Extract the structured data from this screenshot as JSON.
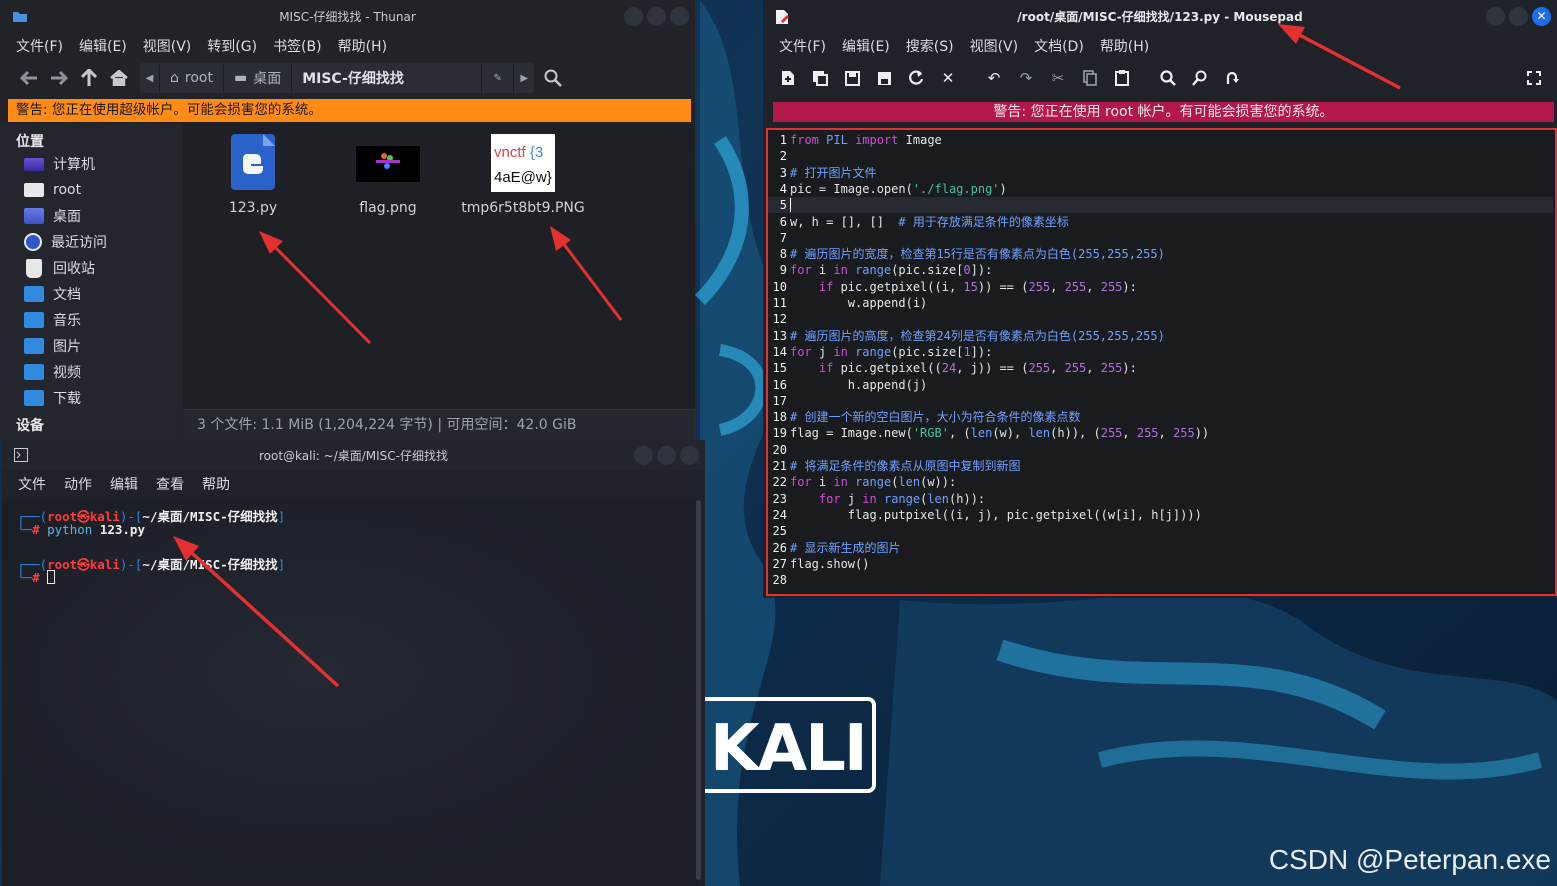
{
  "thunar": {
    "title": "MISC-仔细找找 - Thunar",
    "menu": [
      "文件(F)",
      "编辑(E)",
      "视图(V)",
      "转到(G)",
      "书签(B)",
      "帮助(H)"
    ],
    "path": [
      "root",
      "桌面",
      "MISC-仔细找找"
    ],
    "warning": "警告: 您正在使用超级帐户。可能会损害您的系统。",
    "sidebar": {
      "places_heading": "位置",
      "places": [
        "计算机",
        "root",
        "桌面",
        "最近访问",
        "回收站",
        "文档",
        "音乐",
        "图片",
        "视频",
        "下载"
      ],
      "devices_heading": "设备"
    },
    "files": [
      {
        "name": "123.py",
        "icon": "python-file-icon"
      },
      {
        "name": "flag.png",
        "icon": "image-thumbnail"
      },
      {
        "name": "tmp6r5t8bt9.PNG",
        "icon": "image-thumbnail",
        "thumb_line1_a": "vnctf",
        "thumb_line1_b": "{3",
        "thumb_line2": "4aE@w}"
      }
    ],
    "status": "3 个文件: 1.1 MiB (1,204,224 字节)  |  可用空间：42.0 GiB"
  },
  "terminal": {
    "title": "root@kali: ~/桌面/MISC-仔细找找",
    "menu": [
      "文件",
      "动作",
      "编辑",
      "查看",
      "帮助"
    ],
    "prompt_user": "root",
    "prompt_symbol": "㉿",
    "prompt_host": "kali",
    "prompt_path": "~/桌面/MISC-仔细找找",
    "prompt_hash": "#",
    "command_name": "python",
    "command_arg": "123.py"
  },
  "mousepad": {
    "title": "/root/桌面/MISC-仔细找找/123.py - Mousepad",
    "menu": [
      "文件(F)",
      "编辑(E)",
      "搜索(S)",
      "视图(V)",
      "文档(D)",
      "帮助(H)"
    ],
    "warning": "警告: 您正在使用 root 帐户。有可能会损害您的系统。",
    "toolbar_icons": [
      "new-icon",
      "new-window-icon",
      "save-icon",
      "save-as-icon",
      "reload-icon",
      "close-doc-icon",
      "undo-icon",
      "redo-icon",
      "cut-icon",
      "copy-icon",
      "paste-icon",
      "find-icon",
      "find-replace-icon",
      "goto-icon",
      "fullscreen-icon"
    ],
    "current_line": 5,
    "code": [
      [
        [
          "kw",
          "from"
        ],
        [
          "",
          " "
        ],
        [
          "bi",
          "PIL"
        ],
        [
          "",
          " "
        ],
        [
          "kw",
          "import"
        ],
        [
          "",
          " Image"
        ]
      ],
      [],
      [
        [
          "cm",
          "# 打开图片文件"
        ]
      ],
      [
        [
          "",
          "pic = Image.open("
        ],
        [
          "str",
          "'./flag.png'"
        ],
        [
          "",
          ")"
        ]
      ],
      [],
      [
        [
          "",
          "w, h = [], []  "
        ],
        [
          "cm",
          "# 用于存放满足条件的像素坐标"
        ]
      ],
      [],
      [
        [
          "cm",
          "# 遍历图片的宽度，检查第15行是否有像素点为白色(255,255,255)"
        ]
      ],
      [
        [
          "kw",
          "for"
        ],
        [
          "",
          " i "
        ],
        [
          "kw",
          "in"
        ],
        [
          "",
          " "
        ],
        [
          "bi",
          "range"
        ],
        [
          "",
          "(pic.size["
        ],
        [
          "num",
          "0"
        ],
        [
          "",
          "]):"
        ]
      ],
      [
        [
          "",
          "    "
        ],
        [
          "kw",
          "if"
        ],
        [
          "",
          " pic.getpixel((i, "
        ],
        [
          "num",
          "15"
        ],
        [
          "",
          ")) == ("
        ],
        [
          "num",
          "255"
        ],
        [
          "",
          ", "
        ],
        [
          "num",
          "255"
        ],
        [
          "",
          ", "
        ],
        [
          "num",
          "255"
        ],
        [
          "",
          "):"
        ]
      ],
      [
        [
          "",
          "        w.append(i)"
        ]
      ],
      [],
      [
        [
          "cm",
          "# 遍历图片的高度，检查第24列是否有像素点为白色(255,255,255)"
        ]
      ],
      [
        [
          "kw",
          "for"
        ],
        [
          "",
          " j "
        ],
        [
          "kw",
          "in"
        ],
        [
          "",
          " "
        ],
        [
          "bi",
          "range"
        ],
        [
          "",
          "(pic.size["
        ],
        [
          "num",
          "1"
        ],
        [
          "",
          "]):"
        ]
      ],
      [
        [
          "",
          "    "
        ],
        [
          "kw",
          "if"
        ],
        [
          "",
          " pic.getpixel(("
        ],
        [
          "num",
          "24"
        ],
        [
          "",
          ", j)) == ("
        ],
        [
          "num",
          "255"
        ],
        [
          "",
          ", "
        ],
        [
          "num",
          "255"
        ],
        [
          "",
          ", "
        ],
        [
          "num",
          "255"
        ],
        [
          "",
          "):"
        ]
      ],
      [
        [
          "",
          "        h.append(j)"
        ]
      ],
      [],
      [
        [
          "cm",
          "# 创建一个新的空白图片，大小为符合条件的像素点数"
        ]
      ],
      [
        [
          "",
          "flag = Image.new("
        ],
        [
          "str",
          "'RGB'"
        ],
        [
          "",
          ", ("
        ],
        [
          "bi",
          "len"
        ],
        [
          "",
          "(w), "
        ],
        [
          "bi",
          "len"
        ],
        [
          "",
          "(h)), ("
        ],
        [
          "num",
          "255"
        ],
        [
          "",
          ", "
        ],
        [
          "num",
          "255"
        ],
        [
          "",
          ", "
        ],
        [
          "num",
          "255"
        ],
        [
          "",
          "))"
        ]
      ],
      [],
      [
        [
          "cm",
          "# 将满足条件的像素点从原图中复制到新图"
        ]
      ],
      [
        [
          "kw",
          "for"
        ],
        [
          "",
          " i "
        ],
        [
          "kw",
          "in"
        ],
        [
          "",
          " "
        ],
        [
          "bi",
          "range"
        ],
        [
          "",
          "("
        ],
        [
          "bi",
          "len"
        ],
        [
          "",
          "(w)):"
        ]
      ],
      [
        [
          "",
          "    "
        ],
        [
          "kw",
          "for"
        ],
        [
          "",
          " j "
        ],
        [
          "kw",
          "in"
        ],
        [
          "",
          " "
        ],
        [
          "bi",
          "range"
        ],
        [
          "",
          "("
        ],
        [
          "bi",
          "len"
        ],
        [
          "",
          "(h)):"
        ]
      ],
      [
        [
          "",
          "        flag.putpixel((i, j), pic.getpixel((w[i], h[j])))"
        ]
      ],
      [],
      [
        [
          "cm",
          "# 显示新生成的图片"
        ]
      ],
      [
        [
          "",
          "flag.show()"
        ]
      ],
      []
    ]
  },
  "desktop": {
    "logo_text": "KALI",
    "watermark": "CSDN @Peterpan.exe"
  },
  "colors": {
    "thunar_warning": "#ff8b17",
    "mousepad_warning": "#b3184a",
    "annotation_red": "#e53030",
    "prompt_red": "#ff3b3b",
    "prompt_blue": "#3b7de0"
  }
}
